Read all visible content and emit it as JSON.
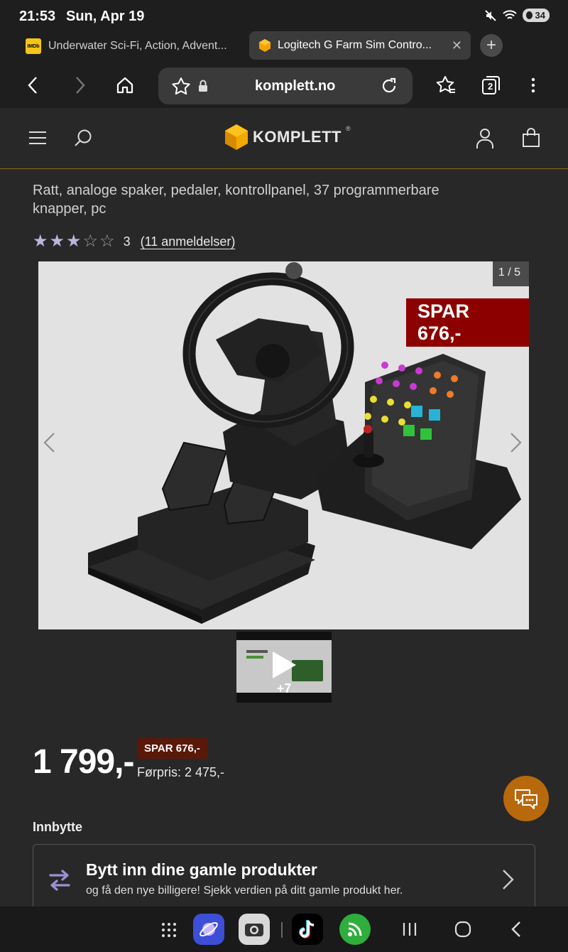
{
  "status": {
    "time": "21:53",
    "date": "Sun, Apr 19",
    "battery": "34"
  },
  "tabs": [
    {
      "title": "Underwater Sci-Fi, Action, Advent...",
      "favicon": "IMDb"
    },
    {
      "title": "Logitech G Farm Sim Contro...",
      "active": true
    }
  ],
  "browser": {
    "url": "komplett.no",
    "tab_count": "2"
  },
  "site": {
    "logo": "KOMPLETT",
    "logo_mark": "®"
  },
  "product": {
    "subtitle": "Ratt, analoge spaker, pedaler, kontrollpanel, 37 programmerbare knapper, pc",
    "rating_value": "3",
    "rating_stars": 3,
    "rating_max": 5,
    "reviews": "(11 anmeldelser)",
    "image_counter": "1 / 5",
    "save_badge": "SPAR 676,-",
    "thumb_more": "+7",
    "price": "1 799,-",
    "save_small": "SPAR 676,-",
    "previous_price": "Førpris: 2 475,-"
  },
  "tradein": {
    "section_label": "Innbytte",
    "title": "Bytt inn dine gamle produkter",
    "subtitle": "og få den nye billigere! Sjekk verdien på ditt gamle produkt her."
  },
  "colors": {
    "badge_red": "#8c0000",
    "chat_orange": "#b8690c",
    "star_fill": "#b8b6de"
  }
}
